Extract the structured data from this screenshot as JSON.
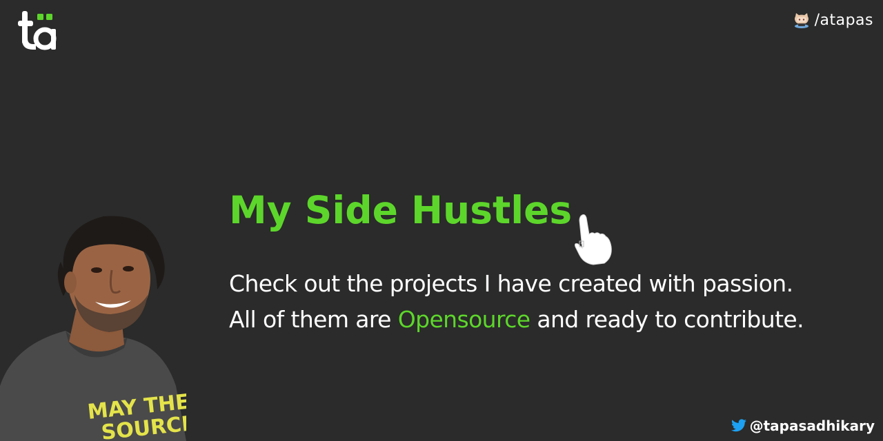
{
  "logo": {
    "text": "ta",
    "accent_color": "#5dd62b"
  },
  "github": {
    "icon": "octocat-icon",
    "handle": "/atapas"
  },
  "headline": "My Side Hustles",
  "description": {
    "line1": "Check out the projects I have created with passion.",
    "line2_before": "All of them are ",
    "line2_highlight": "Opensource",
    "line2_after": " and ready to contribute."
  },
  "shirt_print": "MAY THE SOURCE",
  "twitter": {
    "icon": "twitter-bird-icon",
    "handle": "@tapasadhikary"
  },
  "colors": {
    "background": "#2a2b2a",
    "accent": "#5dd62b",
    "text": "#ffffff",
    "twitter": "#1da1f2"
  }
}
